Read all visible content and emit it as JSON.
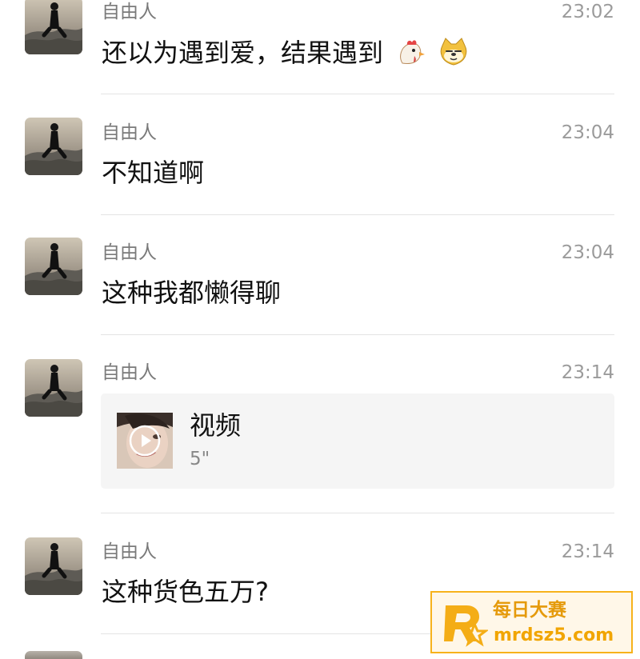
{
  "messages": [
    {
      "sender": "自由人",
      "time": "23:02",
      "text": "还以为遇到爱，结果遇到",
      "emojis": [
        "chicken-icon",
        "doge-icon"
      ]
    },
    {
      "sender": "自由人",
      "time": "23:04",
      "text": "不知道啊"
    },
    {
      "sender": "自由人",
      "time": "23:04",
      "text": "这种我都懒得聊"
    },
    {
      "sender": "自由人",
      "time": "23:14",
      "video": {
        "title": "视频",
        "duration": "5\"",
        "play_icon": "play-icon"
      }
    },
    {
      "sender": "自由人",
      "time": "23:14",
      "text": "这种货色五万?"
    }
  ],
  "watermark": {
    "title": "每日大赛",
    "domain": "mrdsz5.com",
    "accent": "#f7b21b"
  },
  "colors": {
    "background": "#ffffff",
    "divider": "#e4e4e4",
    "meta_text": "#7a7a7a"
  }
}
